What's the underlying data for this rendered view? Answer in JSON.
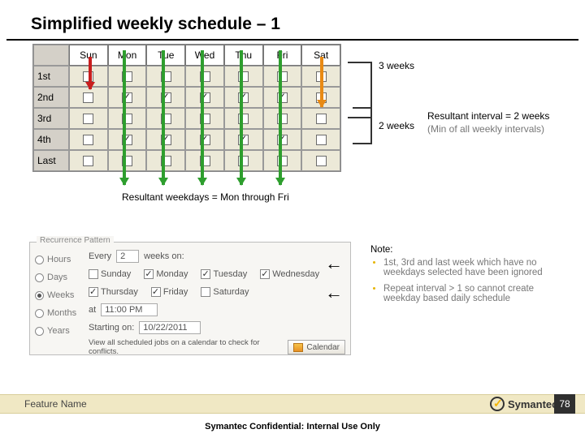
{
  "title": "Simplified weekly schedule – 1",
  "days": [
    "Sun",
    "Mon",
    "Tue",
    "Wed",
    "Thu",
    "Fri",
    "Sat"
  ],
  "rows": [
    "1st",
    "2nd",
    "3rd",
    "4th",
    "Last"
  ],
  "grid_checked": [
    [
      false,
      false,
      false,
      false,
      false,
      false,
      false
    ],
    [
      false,
      true,
      true,
      true,
      true,
      true,
      false
    ],
    [
      false,
      false,
      false,
      false,
      false,
      false,
      false
    ],
    [
      false,
      true,
      true,
      true,
      true,
      true,
      false
    ],
    [
      false,
      false,
      false,
      false,
      false,
      false,
      false
    ]
  ],
  "interval_a_label": "3 weeks",
  "interval_b_label": "2 weeks",
  "result_interval": "Resultant interval = 2 weeks",
  "result_interval_sub": "(Min of all weekly intervals)",
  "result_weekdays": "Resultant weekdays = Mon through Fri",
  "recurrence": {
    "legend": "Recurrence Pattern",
    "modes": [
      "Hours",
      "Days",
      "Weeks",
      "Months",
      "Years"
    ],
    "selected_mode_index": 2,
    "every_label": "Every",
    "every_value": "2",
    "weeks_on": "weeks on:",
    "weekdays": [
      {
        "label": "Sunday",
        "checked": false
      },
      {
        "label": "Monday",
        "checked": true
      },
      {
        "label": "Tuesday",
        "checked": true
      },
      {
        "label": "Wednesday",
        "checked": true
      },
      {
        "label": "Thursday",
        "checked": true
      },
      {
        "label": "Friday",
        "checked": true
      },
      {
        "label": "Saturday",
        "checked": false
      }
    ],
    "at_label": "at",
    "time_value": "11:00 PM",
    "starting_label": "Starting on:",
    "starting_value": "10/22/2011",
    "bottom_text": "View all scheduled jobs on a calendar to check for conflicts.",
    "calendar_btn": "Calendar"
  },
  "notes_heading": "Note:",
  "notes": [
    "1st, 3rd and last week which have no weekdays selected have been ignored",
    "Repeat interval > 1 so cannot create weekday based daily schedule"
  ],
  "footer_feature": "Feature Name",
  "footer_brand": "Symantec.",
  "page_number": "78",
  "confidential": "Symantec Confidential:  Internal Use Only"
}
